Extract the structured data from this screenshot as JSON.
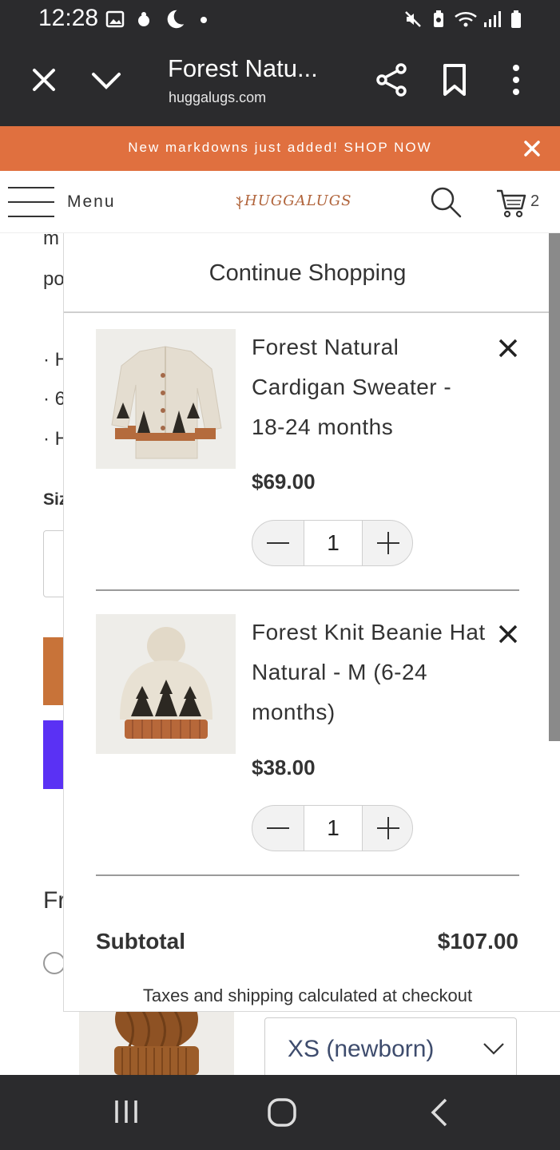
{
  "status_bar": {
    "time": "12:28"
  },
  "browser": {
    "title": "Forest Natu...",
    "url": "huggalugs.com"
  },
  "promo": {
    "text": "New markdowns just added! SHOP NOW"
  },
  "header": {
    "menu_label": "Menu",
    "logo_text": "HUGGALUGS",
    "cart_count": "2"
  },
  "background_page": {
    "line1": "m",
    "line2": "po",
    "bullets": [
      "· H",
      "· 6",
      "· H"
    ],
    "size_label": "Siz",
    "section_label": "Fr",
    "size_select_value": "XS (newborn)"
  },
  "cart": {
    "continue_label": "Continue Shopping",
    "items": [
      {
        "name_lines": [
          "Forest Natural",
          "Cardigan Sweater -",
          "18-24 months"
        ],
        "price": "$69.00",
        "quantity": "1"
      },
      {
        "name_lines": [
          "Forest Knit Beanie Hat",
          "Natural - M (6-24",
          "months)"
        ],
        "price": "$38.00",
        "quantity": "1"
      }
    ],
    "subtotal_label": "Subtotal",
    "subtotal_value": "$107.00",
    "taxes_note": "Taxes and shipping calculated at checkout"
  },
  "colors": {
    "promo_bg": "#e0703f",
    "chrome_bg": "#2b2b2d",
    "brand": "#b0633a",
    "button_orange": "#c87339",
    "button_purple": "#5a31f4"
  }
}
